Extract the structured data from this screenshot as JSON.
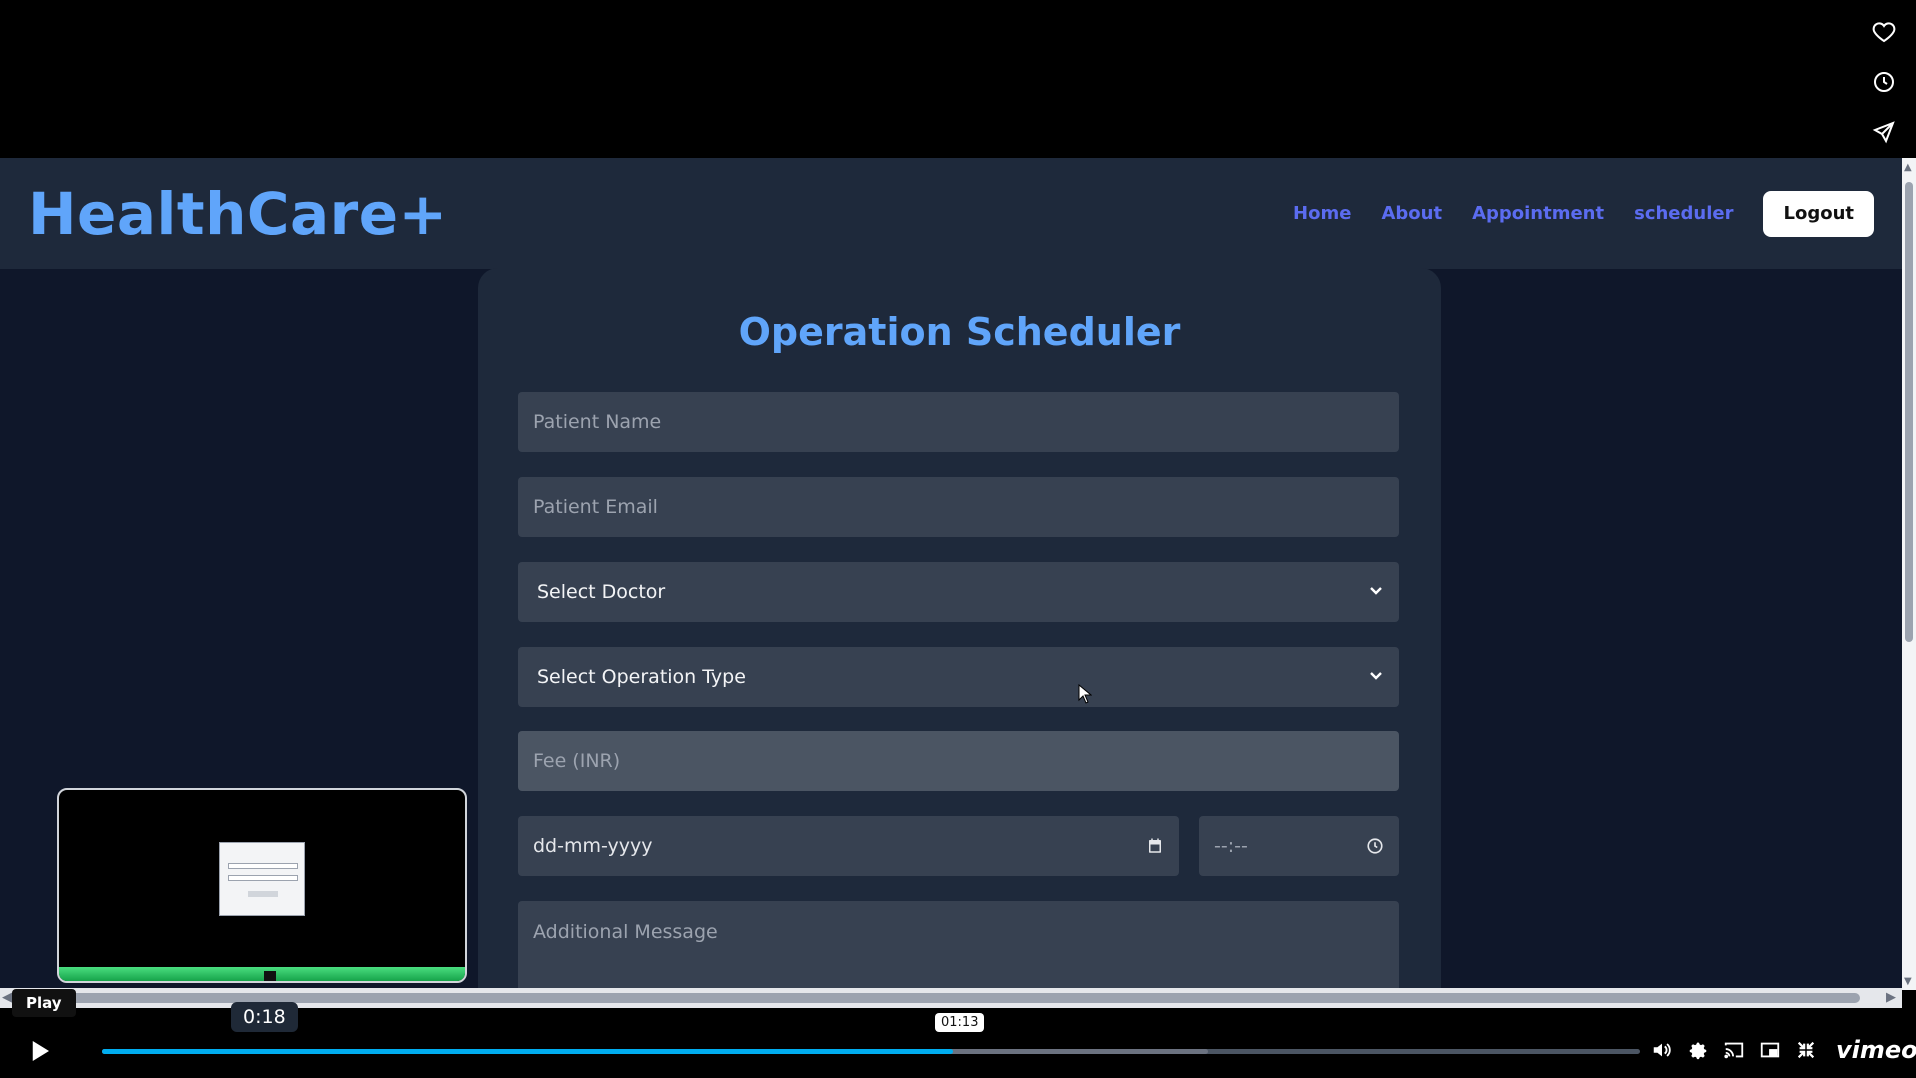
{
  "brand": "HealthCare+",
  "nav": {
    "items": [
      "Home",
      "About",
      "Appointment",
      "scheduler"
    ],
    "logout_label": "Logout"
  },
  "form": {
    "title": "Operation Scheduler",
    "patient_name_placeholder": "Patient Name",
    "patient_email_placeholder": "Patient Email",
    "doctor_select": "Select Doctor",
    "operation_select": "Select Operation Type",
    "fee_placeholder": "Fee (INR)",
    "date_placeholder": "dd-mm-yyyy",
    "time_placeholder": "--:--",
    "message_placeholder": "Additional Message"
  },
  "player": {
    "play_tooltip": "Play",
    "current_time": "0:18",
    "hover_time": "01:13",
    "played_fraction": 0.553,
    "buffered_fraction": 0.719,
    "logo": "vimeo"
  },
  "colors": {
    "brand": "#60a5fa",
    "nav_link": "#5b6cf0",
    "progress": "#00adef"
  },
  "icons": {
    "side": [
      "heart-icon",
      "clock-icon",
      "send-icon"
    ],
    "controls": [
      "volume-icon",
      "settings-icon",
      "cast-icon",
      "pip-icon",
      "fullscreen-exit-icon"
    ]
  }
}
